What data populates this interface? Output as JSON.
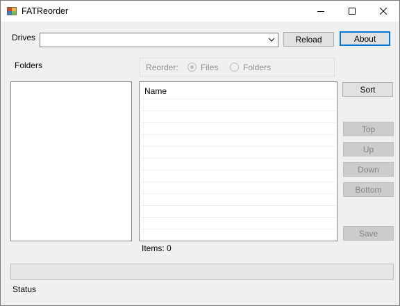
{
  "window": {
    "title": "FATReorder",
    "icon": "app-icon",
    "controls": [
      "minimize-icon",
      "maximize-icon",
      "close-icon"
    ]
  },
  "drives": {
    "label": "Drives",
    "selected_value": "",
    "reload_label": "Reload",
    "about_label": "About"
  },
  "folders": {
    "label": "Folders",
    "items": []
  },
  "reorder": {
    "label": "Reorder:",
    "options": [
      {
        "label": "Files",
        "checked": true
      },
      {
        "label": "Folders",
        "checked": false
      }
    ]
  },
  "files": {
    "column_header": "Name",
    "items": [],
    "items_count_text": "Items: 0"
  },
  "actions": {
    "sort": "Sort",
    "top": "Top",
    "up": "Up",
    "down": "Down",
    "bottom": "Bottom",
    "save": "Save"
  },
  "progress": 0,
  "status": "Status",
  "colors": {
    "window_bg": "#f0f0f0",
    "default_button_border": "#0078d7",
    "disabled_text": "#838383"
  }
}
